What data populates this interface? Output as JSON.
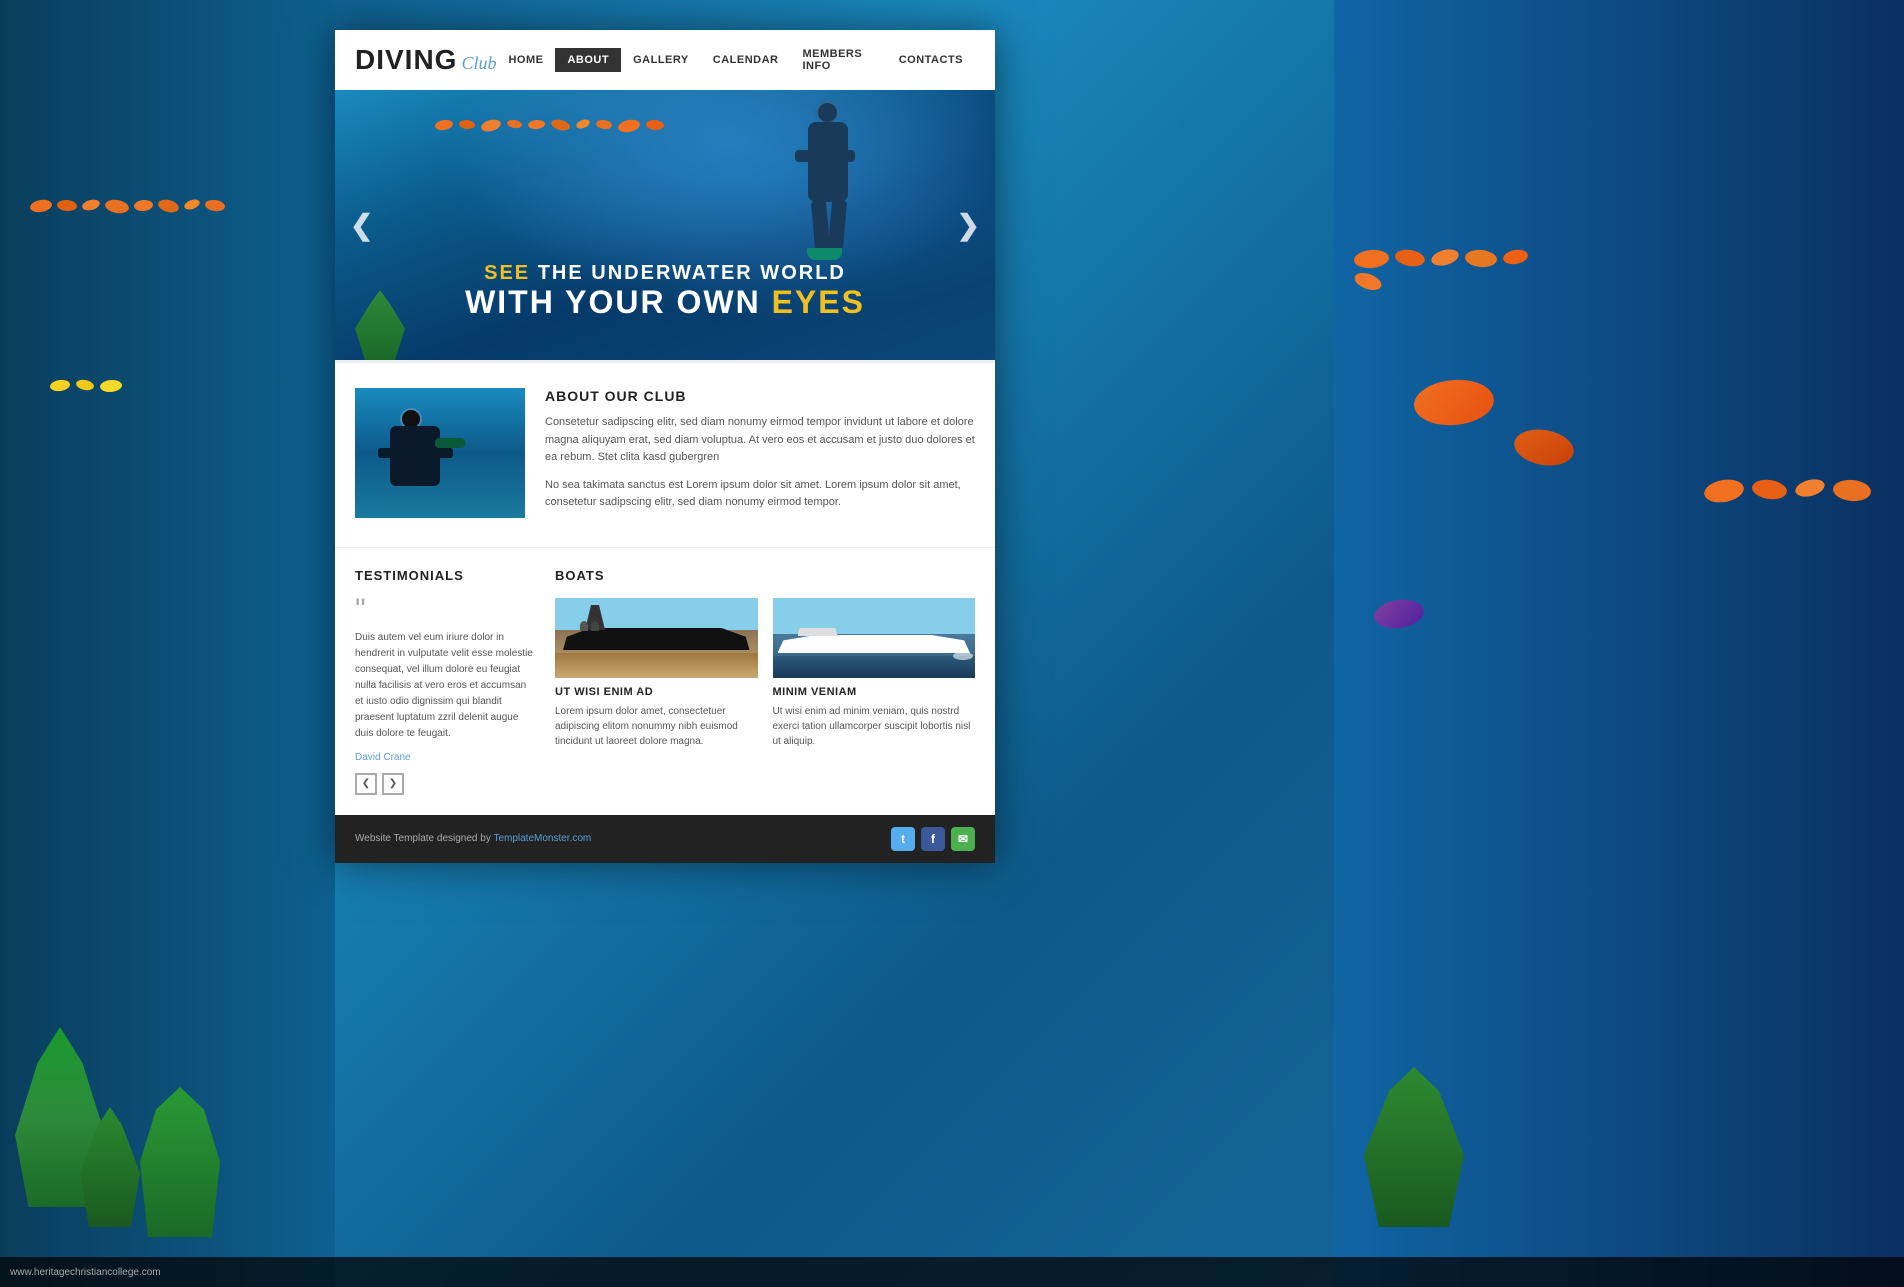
{
  "background": {
    "color": "#1a6fa0"
  },
  "browser": {
    "url": "www.heritagechristiancollege.com"
  },
  "site": {
    "logo": {
      "diving": "DIVING",
      "club": "Club"
    },
    "nav": {
      "items": [
        {
          "label": "HOME",
          "active": false
        },
        {
          "label": "ABOUT",
          "active": true
        },
        {
          "label": "GALLERY",
          "active": false
        },
        {
          "label": "CALENDAR",
          "active": false
        },
        {
          "label": "MEMBERS INFO",
          "active": false
        },
        {
          "label": "CONTACTS",
          "active": false
        }
      ]
    },
    "hero": {
      "line1_prefix": "SEE",
      "line1_suffix": " THE UNDERWATER WORLD",
      "line2_prefix": "WITH YOUR OWN ",
      "line2_suffix": "EYES",
      "arrow_left": "❮",
      "arrow_right": "❯"
    },
    "about": {
      "title": "ABOUT OUR CLUB",
      "text1": "Consetetur sadipscing elitr, sed diam nonumy eirmod tempor invidunt ut labore et dolore magna aliquyam erat, sed diam voluptua. At vero eos et accusam et justo duo dolores et ea rebum. Stet clita kasd gubergren",
      "text2": "No sea takimata sanctus est Lorem ipsum dolor sit amet. Lorem ipsum dolor sit amet, consetetur sadipscing elitr, sed diam nonumy eirmod tempor."
    },
    "testimonials": {
      "title": "TESTIMONIALS",
      "quote": "““",
      "text": "Duis autem vel eum iriure dolor in hendrerit in vulputate velit esse molestie consequat, vel illum dolore eu feugiat nulla facilisis at vero eros et accumsan et iusto odio dignissim qui blandit praesent luptatum zzril delenit augue duis dolore te feugait.",
      "author": "David Crane",
      "nav_prev": "❮",
      "nav_next": "❯"
    },
    "boats": {
      "title": "BOATS",
      "items": [
        {
          "title": "UT WISI ENIM AD",
          "text": "Lorem ipsum dolor amet, consectetuer adipiscing elitom nonummy nibh euismod tincidunt ut laoreet dolore magna."
        },
        {
          "title": "MINIM VENIAM",
          "text": "Ut wisi enim ad minim veniam, quis nostrd exerci tation ullamcorper suscipit lobortis nisl ut aliquip."
        }
      ]
    },
    "footer": {
      "text": "Website Template designed by",
      "link_text": "TemplateMonster.com",
      "socials": [
        "t",
        "f",
        "✉"
      ]
    }
  }
}
